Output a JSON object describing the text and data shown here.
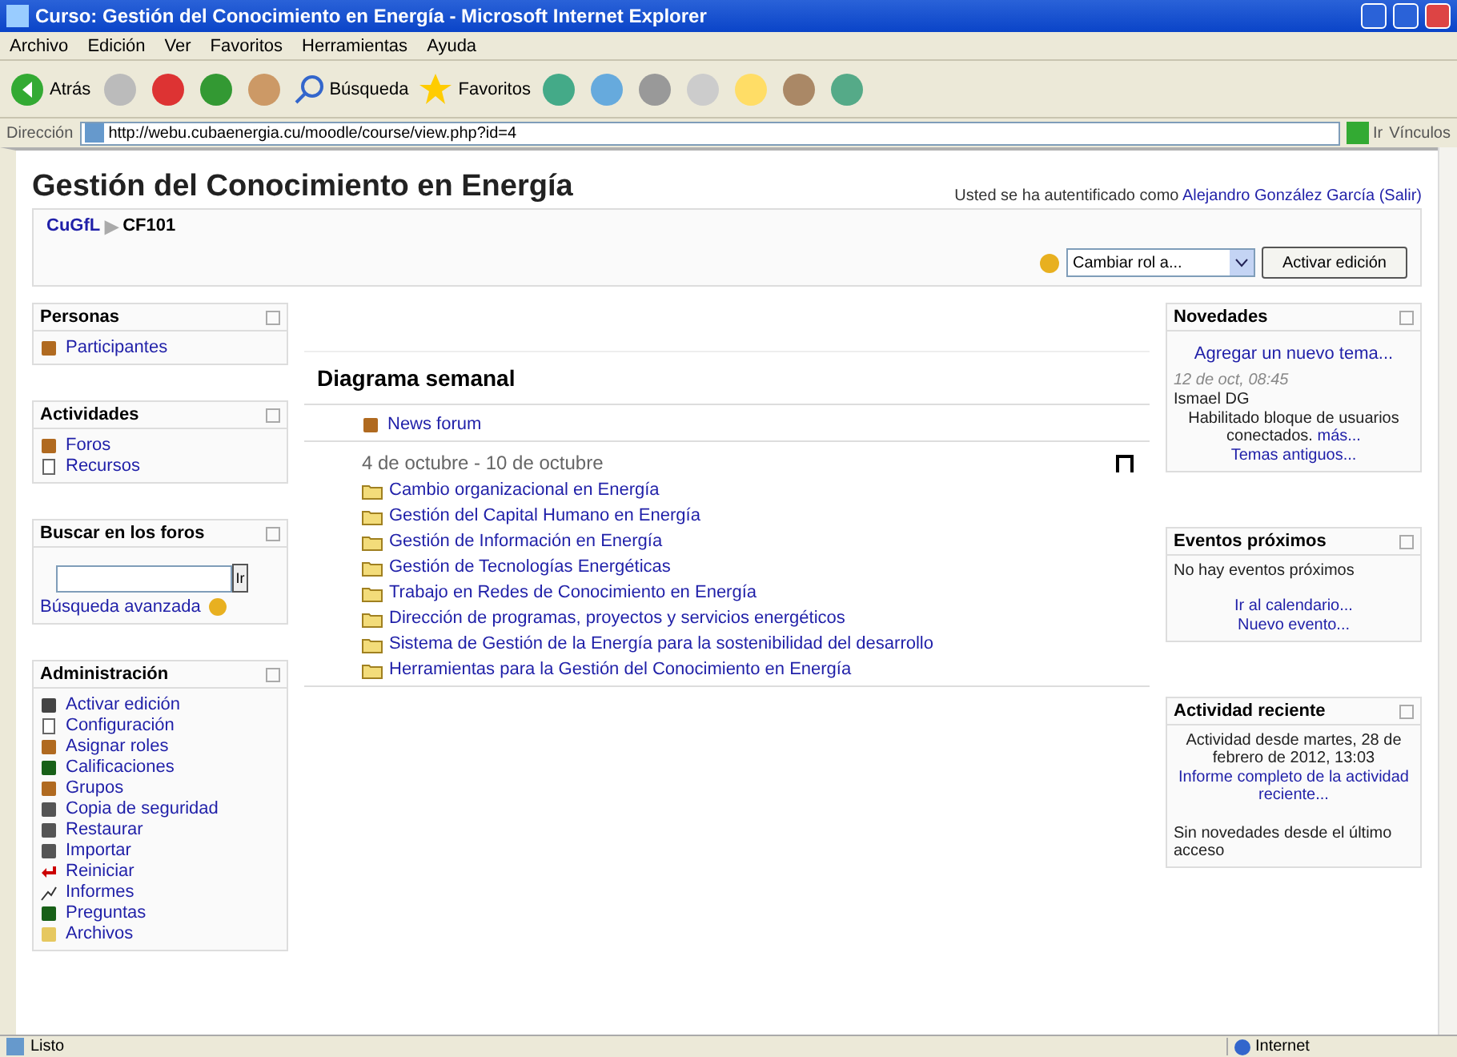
{
  "window": {
    "title": "Curso: Gestión del Conocimiento en Energía - Microsoft Internet Explorer"
  },
  "menu": [
    "Archivo",
    "Edición",
    "Ver",
    "Favoritos",
    "Herramientas",
    "Ayuda"
  ],
  "toolbar": {
    "back": "Atrás",
    "search": "Búsqueda",
    "favorites": "Favoritos"
  },
  "address": {
    "label": "Dirección",
    "url": "http://webu.cubaenergia.cu/moodle/course/view.php?id=4",
    "go": "Ir",
    "links": "Vínculos"
  },
  "header": {
    "title": "Gestión del Conocimiento en Energía",
    "login_text": "Usted se ha autentificado como",
    "user": "Alejandro González García",
    "logout": "(Salir)"
  },
  "breadcrumb": {
    "home": "CuGfL",
    "separator": "▶",
    "current": "CF101"
  },
  "role_select": {
    "value": "Cambiar rol a..."
  },
  "edit_button": "Activar edición",
  "left_blocks": [
    {
      "title": "Personas",
      "kind": "links",
      "items": [
        {
          "label": "Participantes"
        }
      ]
    },
    {
      "title": "Actividades",
      "kind": "links",
      "items": [
        {
          "label": "Foros"
        },
        {
          "label": "Recursos"
        }
      ]
    },
    {
      "title": "Buscar en los foros",
      "kind": "search",
      "button": "Ir",
      "link": "Búsqueda avanzada"
    },
    {
      "title": "Administración",
      "kind": "links",
      "items": [
        {
          "label": "Activar edición"
        },
        {
          "label": "Configuración"
        },
        {
          "label": "Asignar roles"
        },
        {
          "label": "Calificaciones"
        },
        {
          "label": "Grupos"
        },
        {
          "label": "Copia de seguridad"
        },
        {
          "label": "Restaurar"
        },
        {
          "label": "Importar"
        },
        {
          "label": "Reiniciar"
        },
        {
          "label": "Informes"
        },
        {
          "label": "Preguntas"
        },
        {
          "label": "Archivos"
        }
      ]
    }
  ],
  "main": {
    "title": "Diagrama semanal",
    "news": "News forum",
    "week": {
      "dates": "4 de octubre - 10 de octubre",
      "topics": [
        "Cambio organizacional en Energía",
        "Gestión del Capital Humano en Energía",
        "Gestión de Información en Energía",
        "Gestión de Tecnologías Energéticas",
        "Trabajo en Redes de Conocimiento en Energía",
        "Dirección de programas, proyectos y servicios energéticos",
        "Sistema de Gestión de la Energía para la sostenibilidad del desarrollo",
        "Herramientas para la Gestión del Conocimiento en Energía"
      ]
    }
  },
  "news_block": {
    "title": "Novedades",
    "add": "Agregar un nuevo tema...",
    "date": "12 de oct, 08:45",
    "author": "Ismael DG",
    "text": "Habilitado bloque de usuarios conectados.",
    "more": "más...",
    "older": "Temas antiguos..."
  },
  "events_block": {
    "title": "Eventos próximos",
    "text": "No hay eventos próximos",
    "links": [
      "Ir al calendario...",
      "Nuevo evento..."
    ]
  },
  "recent_block": {
    "title": "Actividad reciente",
    "text": "Actividad desde martes, 28 de febrero de 2012, 13:03",
    "link": "Informe completo de la actividad reciente...",
    "note": "Sin novedades desde el último acceso"
  },
  "status_bar": {
    "text": "Listo",
    "zone": "Internet"
  }
}
